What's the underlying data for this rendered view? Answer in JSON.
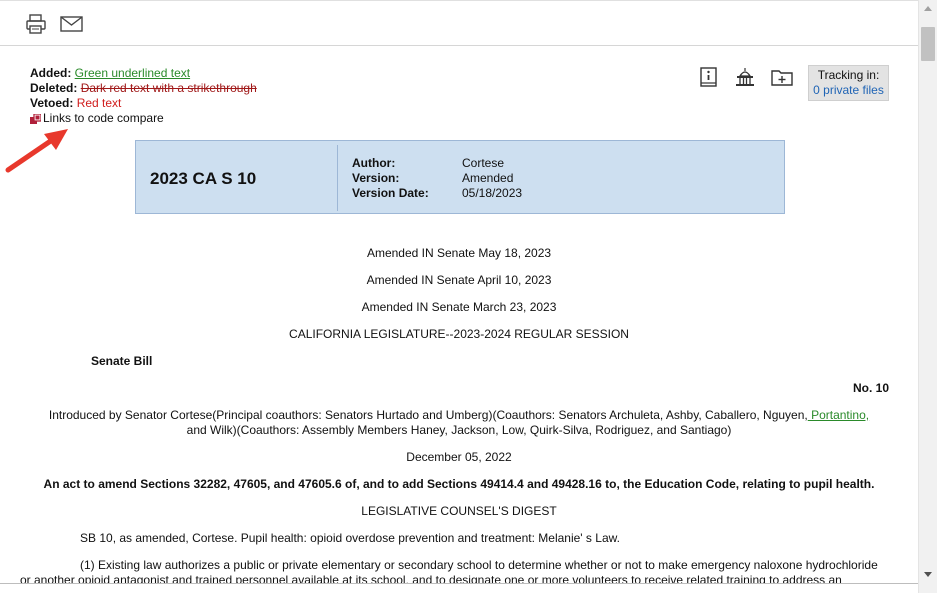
{
  "toolbar": {
    "print_icon": "printer-icon",
    "email_icon": "envelope-icon"
  },
  "legend": {
    "added_label": "Added:",
    "added_text": "Green underlined text",
    "deleted_label": "Deleted:",
    "deleted_text": "Dark red text with a strikethrough",
    "vetoed_label": "Vetoed:",
    "vetoed_text": "Red text",
    "code_link_text": "Links to code compare"
  },
  "tracking": {
    "label": "Tracking in:",
    "link": "0 private files"
  },
  "bill": {
    "number": "2023 CA S 10",
    "author_label": "Author:",
    "author": "Cortese",
    "version_label": "Version:",
    "version": "Amended",
    "version_date_label": "Version Date:",
    "version_date": "05/18/2023"
  },
  "document": {
    "amended_1": "Amended IN Senate May 18, 2023",
    "amended_2": "Amended IN Senate April 10, 2023",
    "amended_3": "Amended IN Senate March 23, 2023",
    "session": "CALIFORNIA LEGISLATURE--2023-2024 REGULAR SESSION",
    "bill_type": "Senate Bill",
    "bill_no": "No. 10",
    "introduced_1a": "Introduced by Senator Cortese(Principal coauthors: Senators Hurtado and Umberg)(Coauthors: Senators Archuleta, Ashby, Caballero, Nguyen,",
    "introduced_1b": " Portantino,",
    "introduced_2": "and Wilk)(Coauthors: Assembly Members Haney, Jackson, Low, Quirk-Silva, Rodriguez, and Santiago)",
    "date": "December 05, 2022",
    "act": "An act to amend Sections 32282, 47605, and 47605.6 of, and to add Sections 49414.4 and 49428.16 to, the Education Code, relating to pupil health.",
    "digest_title": "LEGISLATIVE COUNSEL'S DIGEST",
    "digest_summary": "SB 10, as amended, Cortese. Pupil health: opioid overdose prevention and treatment: Melanie' s Law.",
    "para_1a": "(1) Existing law authorizes a public or private elementary or secondary school to determine whether or not to make emergency naloxone hydrochloride",
    "para_1b": "or another opioid antagonist and trained personnel available at its school, and to designate one or more volunteers to receive related training to address an"
  }
}
